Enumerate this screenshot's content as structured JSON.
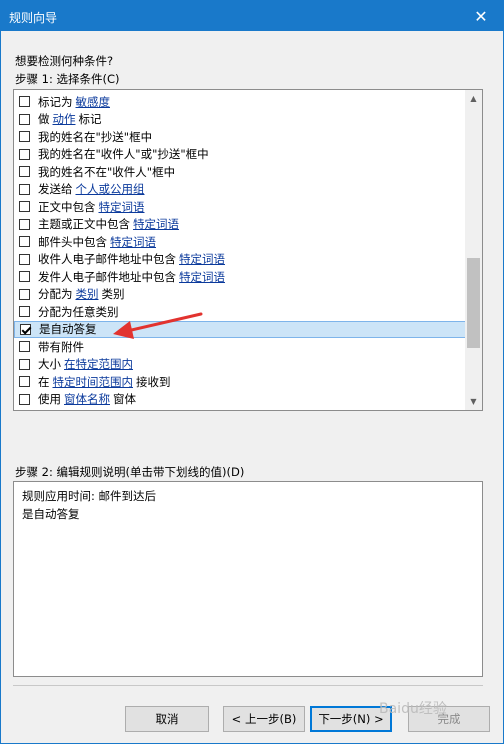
{
  "window": {
    "title": "规则向导",
    "close": "✕"
  },
  "question": "想要检测何种条件?",
  "step1_label": "步骤 1: 选择条件(C)",
  "conditions": [
    {
      "pre": "标记为 ",
      "link": "敏感度",
      "post": "",
      "checked": false
    },
    {
      "pre": "做 ",
      "link": "动作",
      "post": " 标记",
      "checked": false
    },
    {
      "pre": "我的姓名在\"抄送\"框中",
      "link": "",
      "post": "",
      "checked": false
    },
    {
      "pre": "我的姓名在\"收件人\"或\"抄送\"框中",
      "link": "",
      "post": "",
      "checked": false
    },
    {
      "pre": "我的姓名不在\"收件人\"框中",
      "link": "",
      "post": "",
      "checked": false
    },
    {
      "pre": "发送给 ",
      "link": "个人或公用组",
      "post": "",
      "checked": false
    },
    {
      "pre": "正文中包含 ",
      "link": "特定词语",
      "post": "",
      "checked": false
    },
    {
      "pre": "主题或正文中包含 ",
      "link": "特定词语",
      "post": "",
      "checked": false
    },
    {
      "pre": "邮件头中包含 ",
      "link": "特定词语",
      "post": "",
      "checked": false
    },
    {
      "pre": "收件人电子邮件地址中包含 ",
      "link": "特定词语",
      "post": "",
      "checked": false
    },
    {
      "pre": "发件人电子邮件地址中包含 ",
      "link": "特定词语",
      "post": "",
      "checked": false
    },
    {
      "pre": "分配为 ",
      "link": "类别",
      "post": " 类别",
      "checked": false
    },
    {
      "pre": "分配为任意类别",
      "link": "",
      "post": "",
      "checked": false
    },
    {
      "pre": "是自动答复",
      "link": "",
      "post": "",
      "checked": true,
      "selected": true
    },
    {
      "pre": "带有附件",
      "link": "",
      "post": "",
      "checked": false
    },
    {
      "pre": "大小 ",
      "link": "在特定范围内",
      "post": "",
      "checked": false
    },
    {
      "pre": "在 ",
      "link": "特定时间范围内",
      "post": " 接收到",
      "checked": false
    },
    {
      "pre": "使用 ",
      "link": "窗体名称",
      "post": " 窗体",
      "checked": false
    }
  ],
  "step2_label": "步骤 2: 编辑规则说明(单击带下划线的值)(D)",
  "description": [
    "规则应用时间: 邮件到达后",
    "是自动答复"
  ],
  "buttons": {
    "cancel": "取消",
    "back": "< 上一步(B)",
    "next": "下一步(N) >",
    "finish": "完成"
  },
  "watermark": "Baidu经验",
  "colors": {
    "accent": "#1979ca",
    "link": "#0b3a9c",
    "annotation_arrow": "#e2332f",
    "selection": "#cce4f7"
  }
}
